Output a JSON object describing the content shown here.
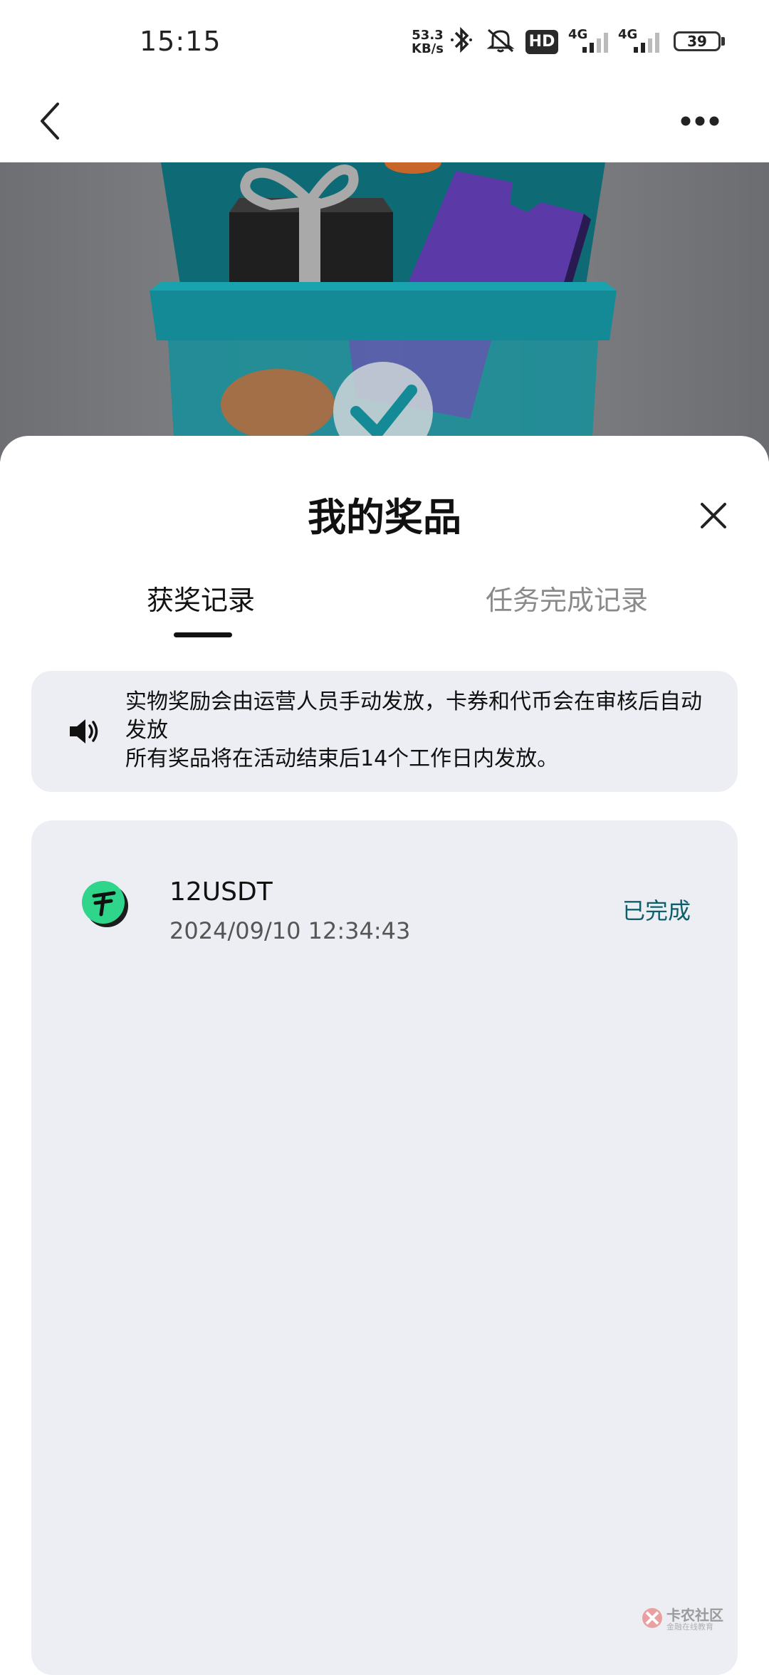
{
  "status_bar": {
    "time": "15:15",
    "net_speed_value": "53.3",
    "net_speed_unit": "KB/s",
    "hd_label": "HD",
    "sim1_label": "4G",
    "sim2_label": "4G",
    "battery": "39"
  },
  "sheet": {
    "title": "我的奖品",
    "tabs": [
      {
        "label": "获奖记录",
        "active": true
      },
      {
        "label": "任务完成记录",
        "active": false
      }
    ],
    "notice": {
      "line1": "实物奖励会由运营人员手动发放，卡券和代币会在审核后自动发放",
      "line2": "所有奖品将在活动结束后14个工作日内发放。"
    },
    "records": [
      {
        "name": "12USDT",
        "datetime": "2024/09/10 12:34:43",
        "status": "已完成",
        "icon": "tether-token-icon"
      }
    ]
  },
  "watermark": {
    "main": "卡农社区",
    "sub": "金融在线教育"
  },
  "colors": {
    "accent_status": "#0f5f6a",
    "card_bg": "#eceef3",
    "token_green": "#2fd58a"
  }
}
